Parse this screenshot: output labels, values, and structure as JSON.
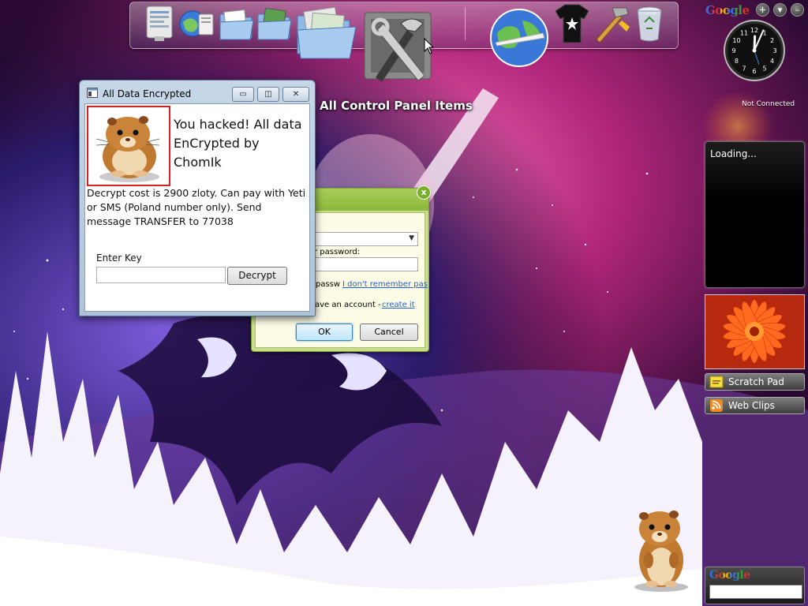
{
  "desktop": {
    "control_panel_label": "All Control Panel Items"
  },
  "dock": {
    "icons": [
      "system-properties-icon",
      "network-globe-icon",
      "documents-folder-icon",
      "pictures-folder-icon",
      "open-folder-icon",
      "tools-icon",
      "internet-globe-icon",
      "t-shirt-icon",
      "hammer-icon",
      "recycle-bin-icon"
    ]
  },
  "sidebar": {
    "google_logo": "Google",
    "add_label": "+",
    "menu_label": "▾",
    "minimize_label": "–",
    "clock_status": "Not Connected",
    "feed": {
      "loading_text": "Loading..."
    },
    "scratch_pad_label": "Scratch Pad",
    "web_clips_label": "Web Clips",
    "google_search_logo": "Google",
    "google_search_value": ""
  },
  "login_dialog": {
    "close_label": "x",
    "password_label": "r password:",
    "remember_label": "passw",
    "forgot_link": "I don't remember pas",
    "account_label": "ave an account -",
    "create_link": "create it",
    "ok_label": "OK",
    "cancel_label": "Cancel"
  },
  "ransom_window": {
    "title": "All Data Encrypted",
    "minimize_label": "▭",
    "maximize_label": "◫",
    "close_label": "✕",
    "headline": "You hacked! All data EnCrypted by ChomIk",
    "message": "Decrypt cost is 2900 zloty. Can pay with Yeti or SMS (Poland number only). Send message TRANSFER to 77038",
    "enter_key_label": "Enter Key",
    "key_value": "",
    "decrypt_label": "Decrypt"
  },
  "colors": {
    "google_blue": "#3b6fd8",
    "google_red": "#d8352a",
    "google_yellow": "#f0b400",
    "google_green": "#3a9a3a",
    "login_green": "#8bb83a",
    "ransom_frame": "#aec3da",
    "image_border_red": "#d82020"
  },
  "clock": {
    "hour": 12,
    "minute": 4
  }
}
